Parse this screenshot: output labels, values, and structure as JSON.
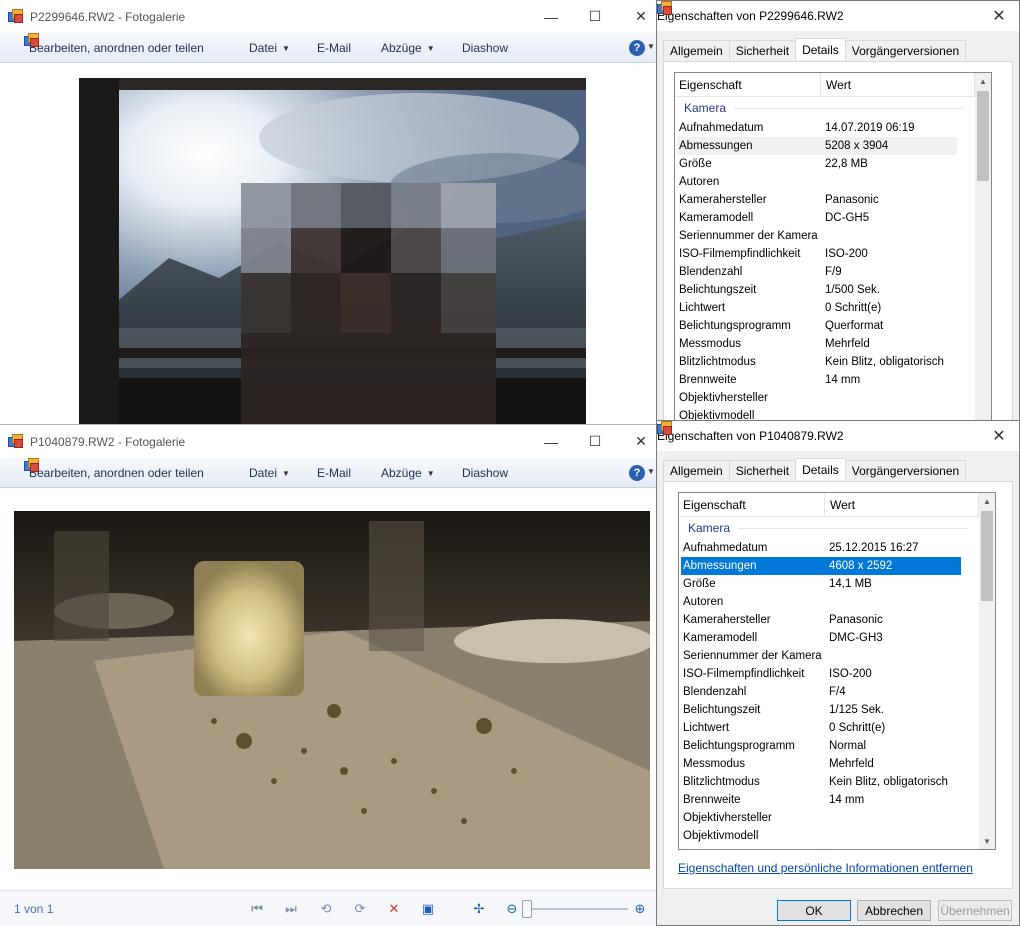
{
  "gallery_top": {
    "title": "P2299646.RW2 - Fotogalerie",
    "toolbar": {
      "organize": "Bearbeiten, anordnen oder teilen",
      "file": "Datei",
      "email": "E-Mail",
      "prints": "Abzüge",
      "slideshow": "Diashow"
    }
  },
  "gallery_bottom": {
    "title": "P1040879.RW2 - Fotogalerie",
    "toolbar": {
      "organize": "Bearbeiten, anordnen oder teilen",
      "file": "Datei",
      "email": "E-Mail",
      "prints": "Abzüge",
      "slideshow": "Diashow"
    },
    "status": {
      "counter": "1 von 1"
    }
  },
  "props_top": {
    "title": "Eigenschaften von P2299646.RW2",
    "tabs": [
      "Allgemein",
      "Sicherheit",
      "Details",
      "Vorgängerversionen"
    ],
    "header": {
      "property": "Eigenschaft",
      "value": "Wert"
    },
    "group": "Kamera",
    "rows": [
      {
        "k": "Aufnahmedatum",
        "v": "14.07.2019 06:19"
      },
      {
        "k": "Abmessungen",
        "v": "5208 x 3904"
      },
      {
        "k": "Größe",
        "v": "22,8 MB"
      },
      {
        "k": "Autoren",
        "v": ""
      },
      {
        "k": "Kamerahersteller",
        "v": "Panasonic"
      },
      {
        "k": "Kameramodell",
        "v": "DC-GH5"
      },
      {
        "k": "Seriennummer der Kamera",
        "v": ""
      },
      {
        "k": "ISO-Filmempfindlichkeit",
        "v": "ISO-200"
      },
      {
        "k": "Blendenzahl",
        "v": "F/9"
      },
      {
        "k": "Belichtungszeit",
        "v": "1/500 Sek."
      },
      {
        "k": "Lichtwert",
        "v": "0 Schritt(e)"
      },
      {
        "k": "Belichtungsprogramm",
        "v": "Querformat"
      },
      {
        "k": "Messmodus",
        "v": "Mehrfeld"
      },
      {
        "k": "Blitzlichtmodus",
        "v": "Kein Blitz, obligatorisch"
      },
      {
        "k": "Brennweite",
        "v": "14 mm"
      },
      {
        "k": "Objektivhersteller",
        "v": ""
      },
      {
        "k": "Objektivmodell",
        "v": ""
      }
    ]
  },
  "props_bottom": {
    "title": "Eigenschaften von P1040879.RW2",
    "tabs": [
      "Allgemein",
      "Sicherheit",
      "Details",
      "Vorgängerversionen"
    ],
    "header": {
      "property": "Eigenschaft",
      "value": "Wert"
    },
    "group": "Kamera",
    "rows": [
      {
        "k": "Aufnahmedatum",
        "v": "25.12.2015 16:27"
      },
      {
        "k": "Abmessungen",
        "v": "4608 x 2592"
      },
      {
        "k": "Größe",
        "v": "14,1 MB"
      },
      {
        "k": "Autoren",
        "v": ""
      },
      {
        "k": "Kamerahersteller",
        "v": "Panasonic"
      },
      {
        "k": "Kameramodell",
        "v": "DMC-GH3"
      },
      {
        "k": "Seriennummer der Kamera",
        "v": ""
      },
      {
        "k": "ISO-Filmempfindlichkeit",
        "v": "ISO-200"
      },
      {
        "k": "Blendenzahl",
        "v": "F/4"
      },
      {
        "k": "Belichtungszeit",
        "v": "1/125 Sek."
      },
      {
        "k": "Lichtwert",
        "v": "0 Schritt(e)"
      },
      {
        "k": "Belichtungsprogramm",
        "v": "Normal"
      },
      {
        "k": "Messmodus",
        "v": "Mehrfeld"
      },
      {
        "k": "Blitzlichtmodus",
        "v": "Kein Blitz, obligatorisch"
      },
      {
        "k": "Brennweite",
        "v": "14 mm"
      },
      {
        "k": "Objektivhersteller",
        "v": ""
      },
      {
        "k": "Objektivmodell",
        "v": ""
      }
    ],
    "remove_link": "Eigenschaften und persönliche Informationen entfernen",
    "buttons": {
      "ok": "OK",
      "cancel": "Abbrechen",
      "apply": "Übernehmen"
    }
  },
  "colors": {
    "selection": "#0078d7",
    "group_heading": "#1e3a8a",
    "link": "#0645ad"
  }
}
